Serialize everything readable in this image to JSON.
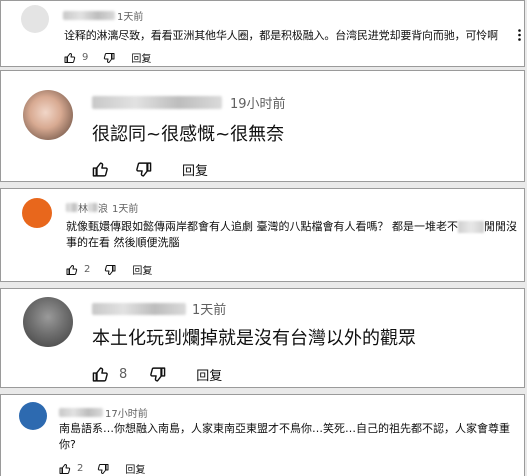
{
  "comments": [
    {
      "time": "1天前",
      "text": "诠释的淋漓尽致，看看亚洲其他华人圈，都是积极融入。台湾民进党却要背向而驰，可怜啊",
      "likes": "9",
      "reply_label": "回复"
    },
    {
      "time": "19小时前",
      "text": "很認同~很感慨~很無奈",
      "likes": "",
      "reply_label": "回复"
    },
    {
      "author_fragment": "林",
      "author_suffix": "浪",
      "avatar_letter": "",
      "time": "1天前",
      "text_before_mask": "就像甄嬛傳跟如懿傳兩岸都會有人追劇 臺灣的八點檔會有人看嗎？ 都是一堆老不",
      "text_after_mask": "閒閒沒事的在看 然後順便洗腦",
      "likes": "2",
      "reply_label": "回复"
    },
    {
      "time": "1天前",
      "text": "本土化玩到爛掉就是沒有台灣以外的觀眾",
      "likes": "8",
      "reply_label": "回复"
    },
    {
      "time": "17小时前",
      "text": "南島語系…你想融入南島，人家東南亞東盟才不鳥你…笑死…自己的祖先都不認，人家會尊重你?",
      "likes": "2",
      "reply_label": "回复"
    }
  ],
  "colors": {
    "avatar_orange": "#e8671c",
    "avatar_blue": "#2d6ab0",
    "border": "#9a9a9a",
    "secondary_text": "#606060"
  },
  "icons": {
    "like": "thumb-up-icon",
    "dislike": "thumb-down-icon",
    "more": "more-vertical-icon"
  }
}
